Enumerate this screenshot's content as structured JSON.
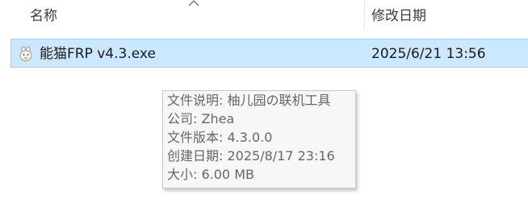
{
  "columns": {
    "name": "名称",
    "date_modified": "修改日期"
  },
  "file": {
    "name": "能猫FRP v4.3.exe",
    "date_modified": "2025/6/21 13:56",
    "icon": "app-mascot-icon"
  },
  "tooltip": {
    "lines": [
      "文件说明: 柚儿园の联机工具",
      "公司: Zhea",
      "文件版本: 4.3.0.0",
      "创建日期: 2025/8/17 23:16",
      "大小: 6.00 MB"
    ]
  },
  "colors": {
    "selection_bg": "#cce8ff",
    "selection_border": "#99d1ff",
    "tooltip_bg": "#f7f7f7",
    "tooltip_text": "#666666"
  }
}
